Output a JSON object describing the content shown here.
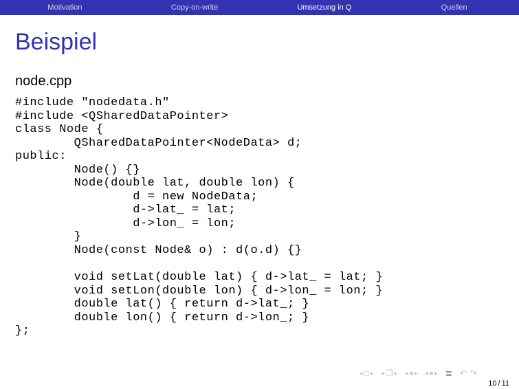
{
  "nav": {
    "items": [
      {
        "label": "Motivation",
        "active": false
      },
      {
        "label": "Copy-on-write",
        "active": false
      },
      {
        "label": "Umsetzung in Q",
        "active": true
      },
      {
        "label": "Quellen",
        "active": false
      }
    ]
  },
  "slide": {
    "title": "Beispiel",
    "subtitle": "node.cpp",
    "code": "#include \"nodedata.h\"\n#include <QSharedDataPointer>\nclass Node {\n        QSharedDataPointer<NodeData> d;\npublic:\n        Node() {}\n        Node(double lat, double lon) {\n                d = new NodeData;\n                d->lat_ = lat;\n                d->lon_ = lon;\n        }\n        Node(const Node& o) : d(o.d) {}\n\n        void setLat(double lat) { d->lat_ = lat; }\n        void setLon(double lon) { d->lon_ = lon; }\n        double lat() { return d->lat_; }\n        double lon() { return d->lon_; }\n};"
  },
  "page": {
    "current": "10",
    "total": "11"
  }
}
